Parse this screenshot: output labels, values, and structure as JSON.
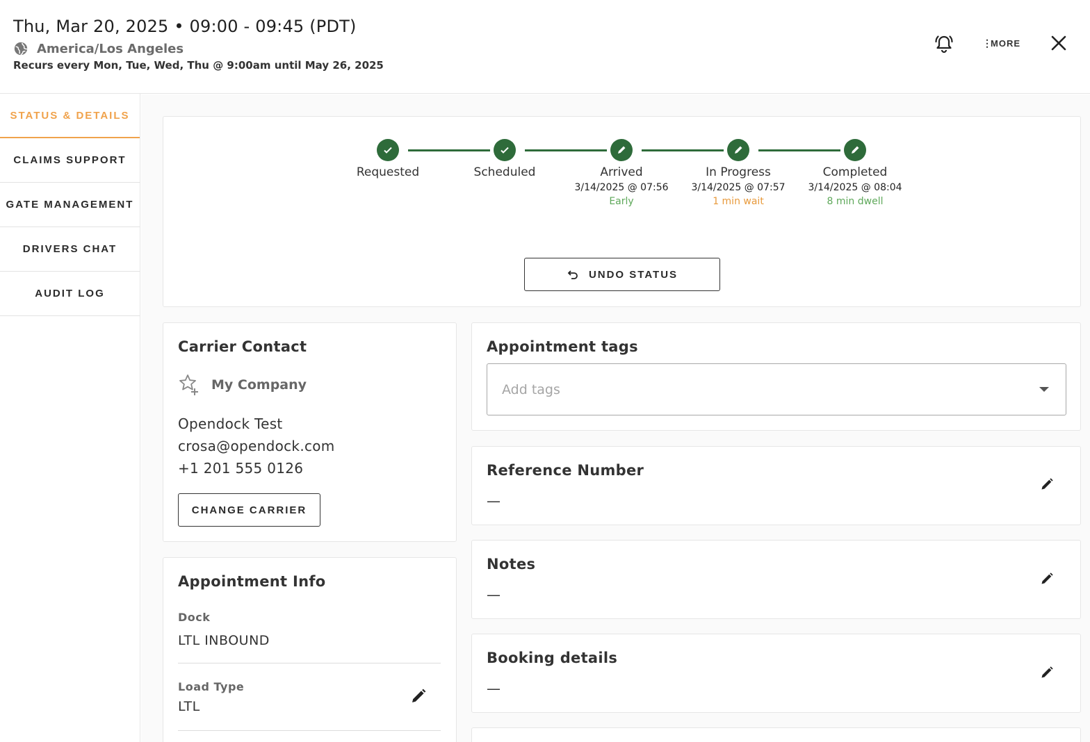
{
  "header": {
    "date_time": "Thu, Mar 20, 2025  •  09:00 - 09:45 (PDT)",
    "timezone": "America/Los Angeles",
    "recurrence": "Recurs every Mon, Tue, Wed, Thu @ 9:00am until May 26, 2025",
    "more_label": "MORE",
    "icons": {
      "timezone": "globe-icon",
      "notifications": "bell-ring-icon",
      "more": "more-vertical-icon",
      "close": "close-icon"
    }
  },
  "sidebar": {
    "items": [
      {
        "label": "STATUS & DETAILS",
        "active": true
      },
      {
        "label": "CLAIMS SUPPORT",
        "active": false
      },
      {
        "label": "GATE MANAGEMENT",
        "active": false
      },
      {
        "label": "DRIVERS CHAT",
        "active": false
      },
      {
        "label": "AUDIT LOG",
        "active": false
      }
    ],
    "active_color": "#f0a24b"
  },
  "status": {
    "steps": [
      {
        "label": "Requested",
        "icon": "check-icon",
        "timestamp": "",
        "sub": "",
        "sub_color": ""
      },
      {
        "label": "Scheduled",
        "icon": "check-icon",
        "timestamp": "",
        "sub": "",
        "sub_color": ""
      },
      {
        "label": "Arrived",
        "icon": "pencil-icon",
        "timestamp": "3/14/2025 @ 07:56",
        "sub": "Early",
        "sub_color": "#5ea85a"
      },
      {
        "label": "In Progress",
        "icon": "pencil-icon",
        "timestamp": "3/14/2025 @ 07:57",
        "sub": "1 min wait",
        "sub_color": "#e89a3c"
      },
      {
        "label": "Completed",
        "icon": "pencil-icon",
        "timestamp": "3/14/2025 @ 08:04",
        "sub": "8 min dwell",
        "sub_color": "#5ea85a"
      }
    ],
    "step_color": "#2e6b3a",
    "undo_label": "UNDO STATUS"
  },
  "carrier": {
    "title": "Carrier Contact",
    "company": "My Company",
    "name": "Opendock Test",
    "email": "crosa@opendock.com",
    "phone": "+1 201 555 0126",
    "change_label": "CHANGE CARRIER"
  },
  "appointment_info": {
    "title": "Appointment Info",
    "dock_label": "Dock",
    "dock_value": "LTL INBOUND",
    "load_type_label": "Load Type",
    "load_type_value": "LTL"
  },
  "tags": {
    "title": "Appointment tags",
    "placeholder": "Add tags"
  },
  "reference": {
    "title": "Reference Number",
    "value": "—"
  },
  "notes": {
    "title": "Notes",
    "value": "—"
  },
  "booking": {
    "title": "Booking details",
    "value": "—"
  }
}
